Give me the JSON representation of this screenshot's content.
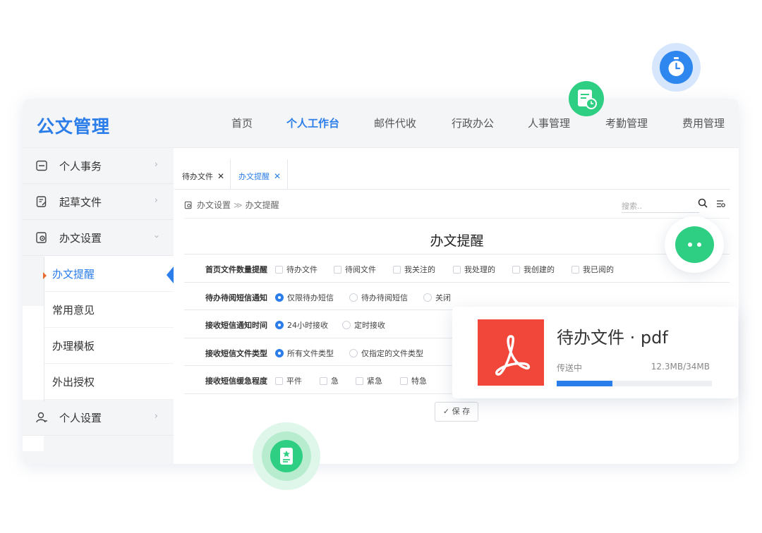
{
  "app": {
    "title": "公文管理"
  },
  "nav": [
    {
      "label": "首页"
    },
    {
      "label": "个人工作台"
    },
    {
      "label": "邮件代收"
    },
    {
      "label": "行政办公"
    },
    {
      "label": "人事管理"
    },
    {
      "label": "考勤管理"
    },
    {
      "label": "费用管理"
    }
  ],
  "sidebar": {
    "items": [
      {
        "label": "个人事务",
        "icon": "list-icon"
      },
      {
        "label": "起草文件",
        "icon": "edit-doc-icon"
      },
      {
        "label": "办文设置",
        "icon": "doc-settings-icon"
      },
      {
        "label": "个人设置",
        "icon": "user-icon"
      }
    ],
    "sub_items": [
      {
        "label": "办文提醒"
      },
      {
        "label": "常用意见"
      },
      {
        "label": "办理模板"
      },
      {
        "label": "外出授权"
      }
    ]
  },
  "tabs": [
    {
      "label": "待办文件",
      "close": "✕"
    },
    {
      "label": "办文提醒",
      "close": "✕"
    }
  ],
  "breadcrumb": {
    "root": "办文设置",
    "sep": "≫",
    "current": "办文提醒"
  },
  "search": {
    "placeholder": "搜索.."
  },
  "form": {
    "title": "办文提醒",
    "rows": [
      {
        "label": "首页文件数量提醒",
        "options": [
          "待办文件",
          "待阅文件",
          "我关注的",
          "我处理的",
          "我创建的",
          "我已阅的"
        ]
      },
      {
        "label": "待办待阅短信通知",
        "options": [
          "仅限待办短信",
          "待办待阅短信",
          "关闭"
        ]
      },
      {
        "label": "接收短信通知时间",
        "options": [
          "24小时接收",
          "定时接收"
        ]
      },
      {
        "label": "接收短信文件类型",
        "options": [
          "所有文件类型",
          "仅指定的文件类型"
        ]
      },
      {
        "label": "接收短信缓急程度",
        "options": [
          "平件",
          "急",
          "紧急",
          "特急"
        ]
      }
    ],
    "save_label": "✓ 保 存"
  },
  "upload": {
    "filename": "待办文件 · pdf",
    "status": "传送中",
    "size": "12.3MB/34MB",
    "progress": 0.36,
    "icon": "acrobat-pdf-icon"
  },
  "colors": {
    "accent": "#2b7de9",
    "green": "#2fcf83",
    "pdf_red": "#f0473a"
  }
}
